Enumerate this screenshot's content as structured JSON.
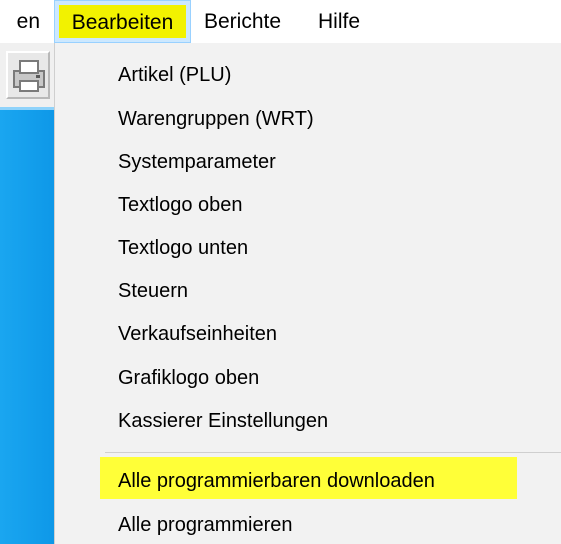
{
  "menubar": {
    "partial_label": "en",
    "items": [
      {
        "label": "Bearbeiten"
      },
      {
        "label": "Berichte"
      },
      {
        "label": "Hilfe"
      }
    ]
  },
  "dropdown": {
    "items": [
      {
        "label": "Artikel (PLU)"
      },
      {
        "label": "Warengruppen (WRT)"
      },
      {
        "label": "Systemparameter"
      },
      {
        "label": "Textlogo oben"
      },
      {
        "label": "Textlogo unten"
      },
      {
        "label": "Steuern"
      },
      {
        "label": "Verkaufseinheiten"
      },
      {
        "label": "Grafiklogo oben"
      },
      {
        "label": "Kassierer Einstellungen"
      }
    ],
    "after_separator": [
      {
        "label": "Alle programmierbaren downloaden"
      },
      {
        "label": "Alle programmieren"
      }
    ]
  },
  "colors": {
    "highlight": "#f2f200",
    "menu_background": "#f2f2f2",
    "app_panel": "#1aa6f0"
  },
  "icons": {
    "toolbar_button": "printer-icon"
  }
}
